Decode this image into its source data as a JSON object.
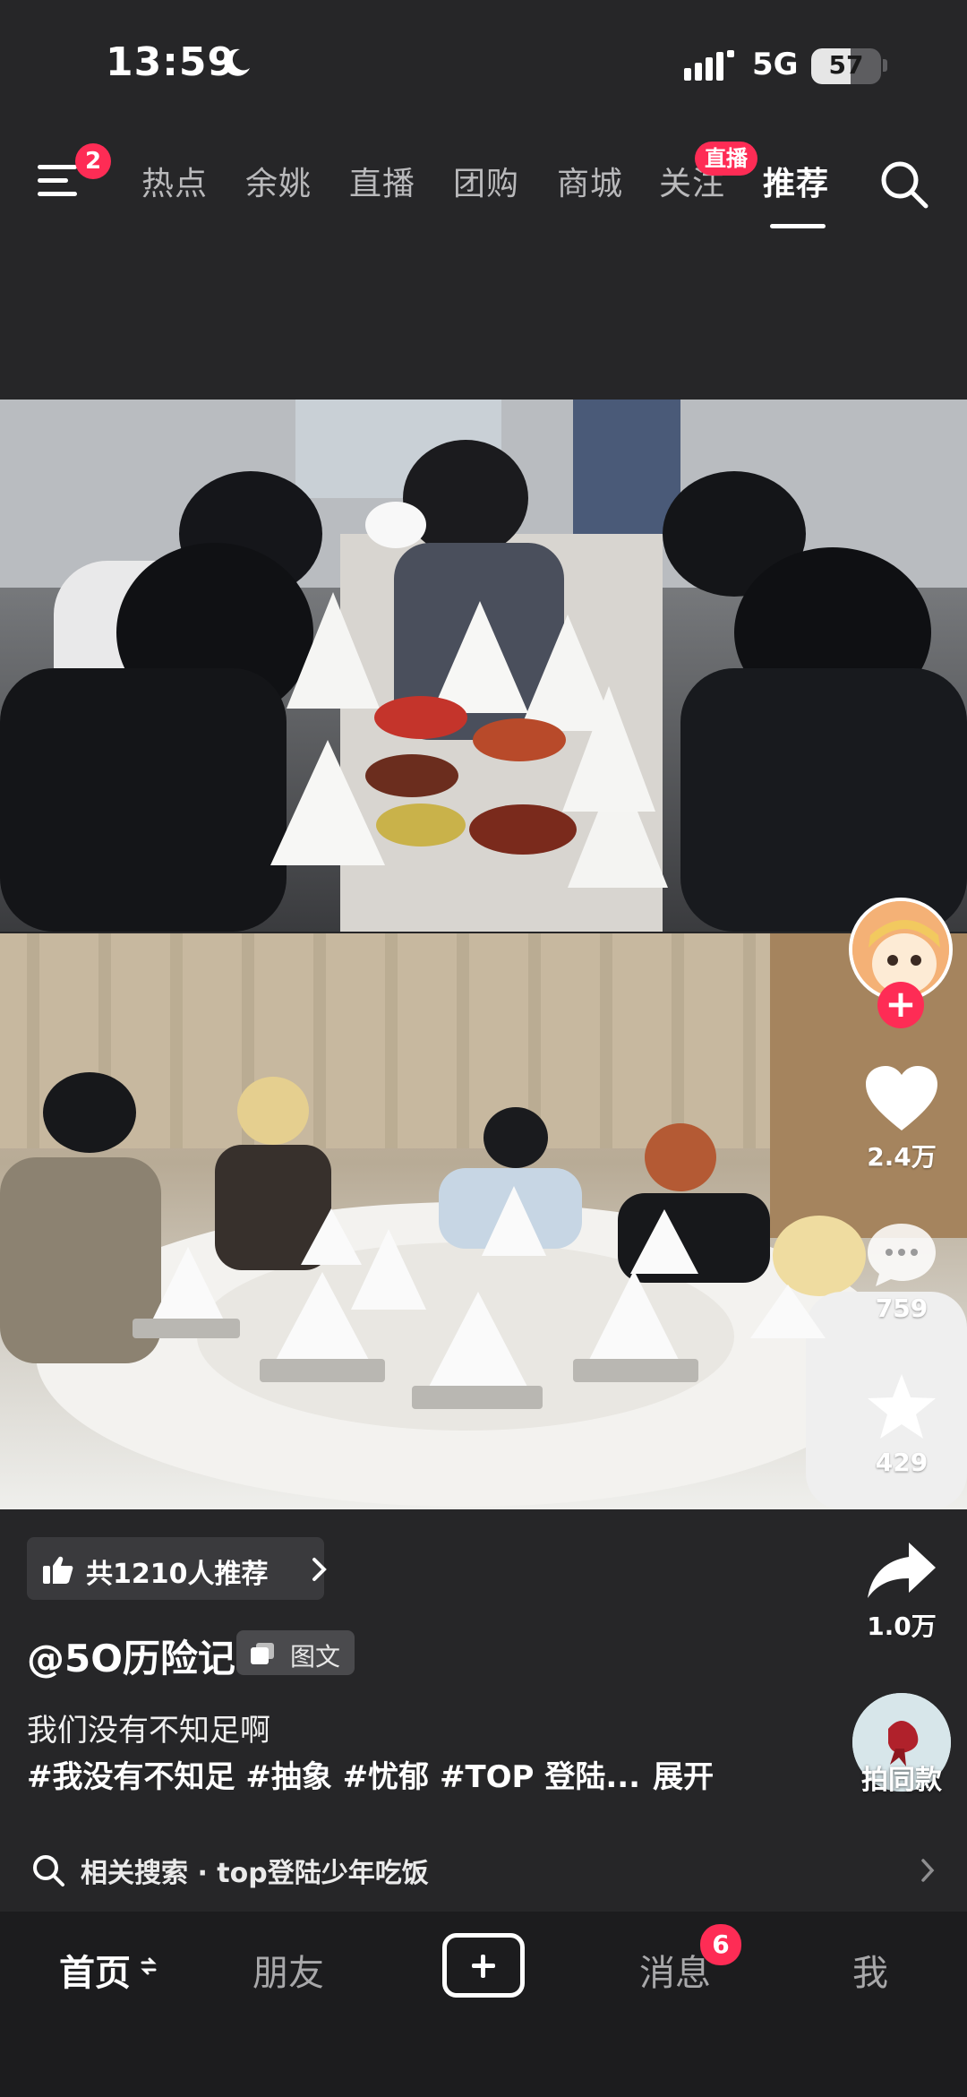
{
  "status_bar": {
    "time": "13:59",
    "network": "5G",
    "battery_level": "57",
    "battery_fraction": 0.57
  },
  "top_nav": {
    "menu_badge": "2",
    "tabs": [
      {
        "label": "热点"
      },
      {
        "label": "余姚"
      },
      {
        "label": "直播"
      },
      {
        "label": "团购"
      },
      {
        "label": "商城"
      },
      {
        "label": "关注"
      },
      {
        "label": "推荐"
      }
    ],
    "active_tab": "推荐",
    "live_badge": "直播"
  },
  "right_rail": {
    "like_count": "2.4万",
    "comment_count": "759",
    "favorite_count": "429",
    "share_count": "1.0万"
  },
  "post": {
    "recommend_chip": "共1210人推荐",
    "author": "@5O历险记",
    "type_tag": "图文",
    "description": "我们没有不知足啊",
    "hashtags": "#我没有不知足 #抽象 #忧郁 #TOP 登陆...",
    "expand_label": "展开",
    "same_style_label": "拍同款"
  },
  "related_search": {
    "label": "相关搜索 · top登陆少年吃饭"
  },
  "bottom_nav": {
    "home": "首页",
    "friends": "朋友",
    "messages": "消息",
    "messages_badge": "6",
    "me": "我"
  },
  "colors": {
    "background": "#262628",
    "accent_red": "#fe2c55",
    "bottom_bar": "#1c1c1e",
    "inactive_text": "#b9b9bb"
  },
  "icons": [
    "menu-icon",
    "search-icon",
    "moon-icon",
    "signal-icon",
    "heart-icon",
    "comment-icon",
    "star-icon",
    "share-icon",
    "thumbs-up-icon",
    "chevron-right-icon",
    "gallery-icon",
    "refresh-icon",
    "plus-icon"
  ]
}
